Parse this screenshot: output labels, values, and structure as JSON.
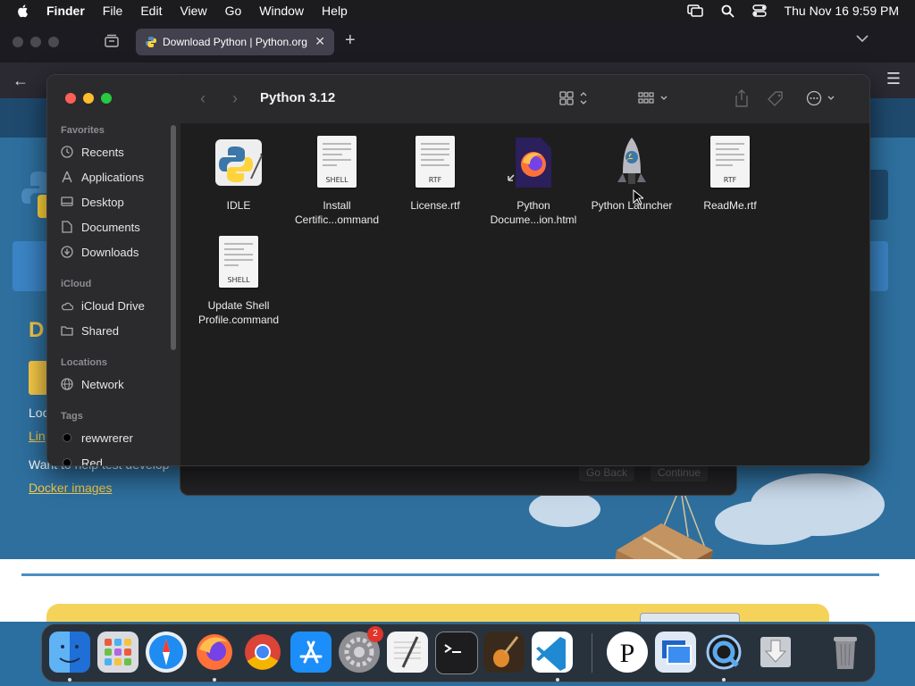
{
  "menubar": {
    "app": "Finder",
    "items": [
      "File",
      "Edit",
      "View",
      "Go",
      "Window",
      "Help"
    ],
    "datetime": "Thu Nov 16  9:59 PM"
  },
  "browser": {
    "tab_title": "Download Python | Python.org"
  },
  "page": {
    "heading_fragment": "D",
    "text1": "Loo",
    "link1": "Lin",
    "text2": "Want to help test develop",
    "link2": "Docker images"
  },
  "installer": {
    "back_label": "Go Back",
    "continue_label": "Continue"
  },
  "finder": {
    "title": "Python 3.12",
    "sidebar": {
      "favorites_heading": "Favorites",
      "favorites": [
        "Recents",
        "Applications",
        "Desktop",
        "Documents",
        "Downloads"
      ],
      "icloud_heading": "iCloud",
      "icloud": [
        "iCloud Drive",
        "Shared"
      ],
      "locations_heading": "Locations",
      "locations": [
        "Network"
      ],
      "tags_heading": "Tags",
      "tags": [
        "rewwrerer",
        "Red"
      ]
    },
    "files": [
      {
        "name": "IDLE",
        "kind": "app"
      },
      {
        "name": "Install Certific...ommand",
        "kind": "shell",
        "tag": "SHELL"
      },
      {
        "name": "License.rtf",
        "kind": "rtf",
        "tag": "RTF"
      },
      {
        "name": "Python Docume...ion.html",
        "kind": "html"
      },
      {
        "name": "Python Launcher",
        "kind": "app"
      },
      {
        "name": "ReadMe.rtf",
        "kind": "rtf",
        "tag": "RTF"
      },
      {
        "name": "Update Shell Profile.command",
        "kind": "shell",
        "tag": "SHELL"
      }
    ]
  },
  "dock": {
    "settings_badge": "2",
    "apps": [
      "Finder",
      "Launchpad",
      "Safari",
      "Firefox",
      "Chrome",
      "App Store",
      "System Settings",
      "TextEdit",
      "Terminal",
      "GarageBand",
      "VS Code",
      "Pockity",
      "Remote Desktop",
      "QuickTime Player",
      "Downloads",
      "Trash"
    ]
  },
  "colors": {
    "accent": "#0a84ff",
    "close": "#ff5f57",
    "minimize": "#febc2e",
    "zoom": "#28c840"
  }
}
